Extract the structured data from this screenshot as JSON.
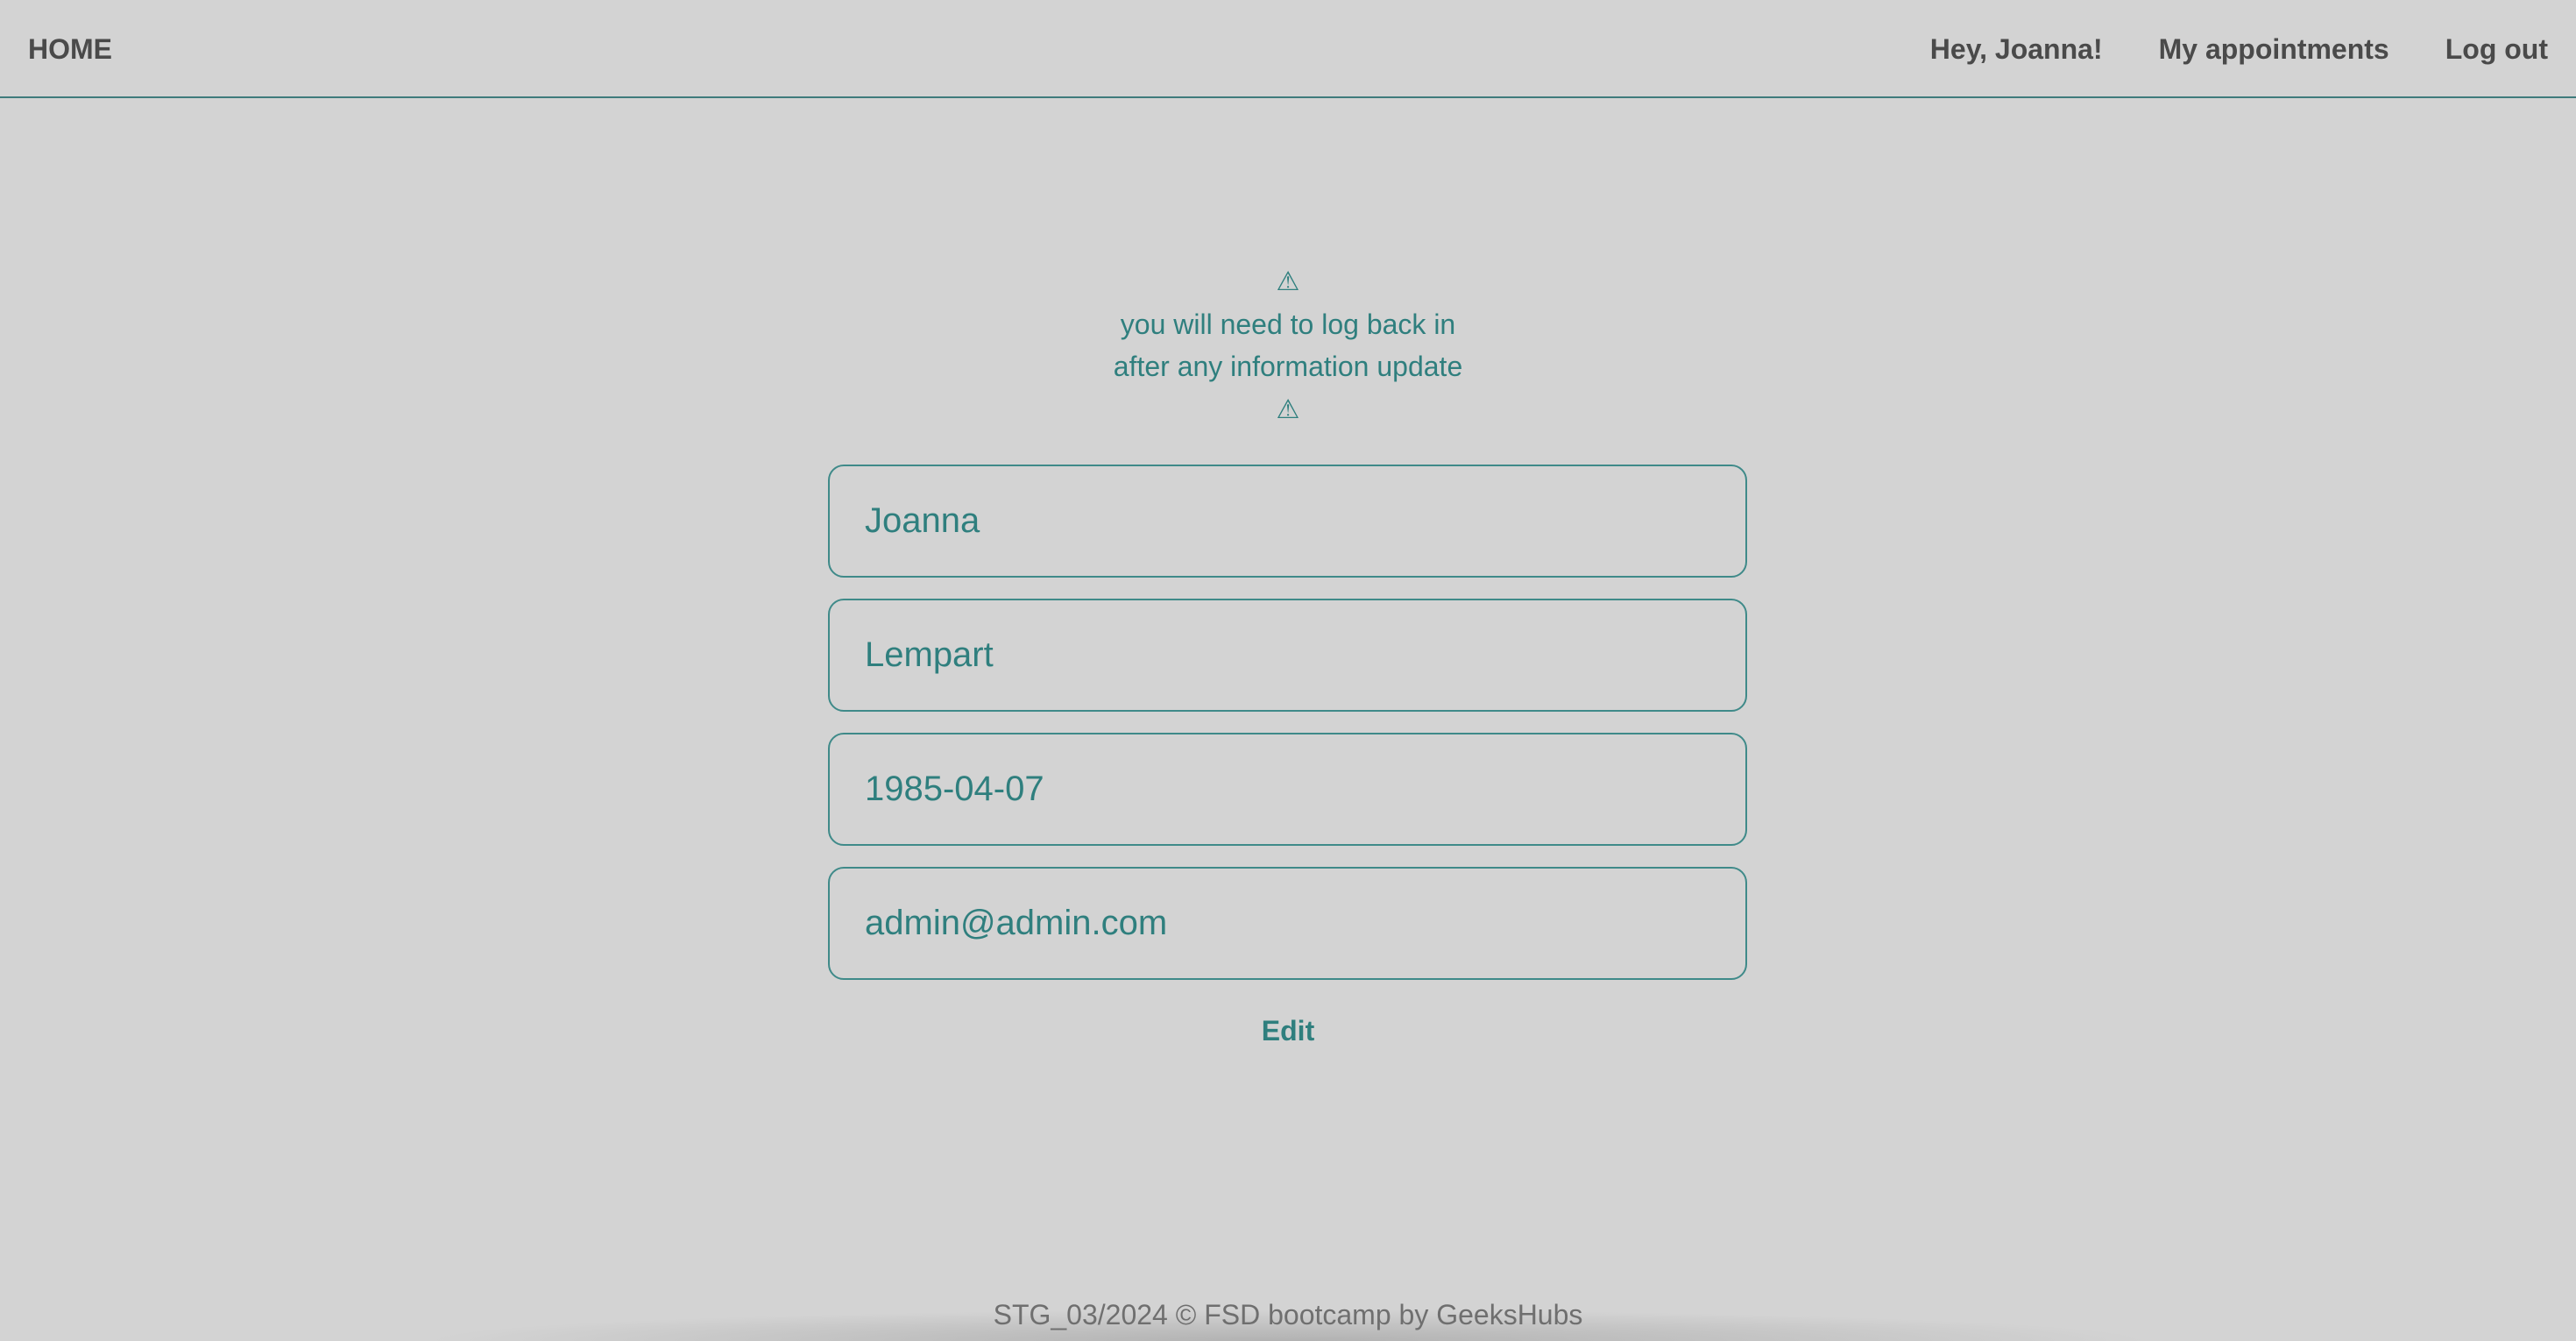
{
  "nav": {
    "home": "HOME",
    "greeting": "Hey, Joanna!",
    "appointments": "My appointments",
    "logout": "Log out"
  },
  "warning": {
    "icon_top": "⚠",
    "line1": "you will need to log back in",
    "line2": "after any information update",
    "icon_bottom": "⚠"
  },
  "form": {
    "first_name": "Joanna",
    "last_name": "Lempart",
    "birth_date": "1985-04-07",
    "email": "admin@admin.com",
    "edit_label": "Edit"
  },
  "footer": {
    "text": "STG_03/2024 © FSD bootcamp by GeeksHubs"
  },
  "colors": {
    "background": "#d3d3d3",
    "accent": "#2f7f7e",
    "nav_text": "#4a4a4a",
    "footer_text": "#6f6f6f"
  },
  "icons": {
    "warning": "warning-icon"
  }
}
